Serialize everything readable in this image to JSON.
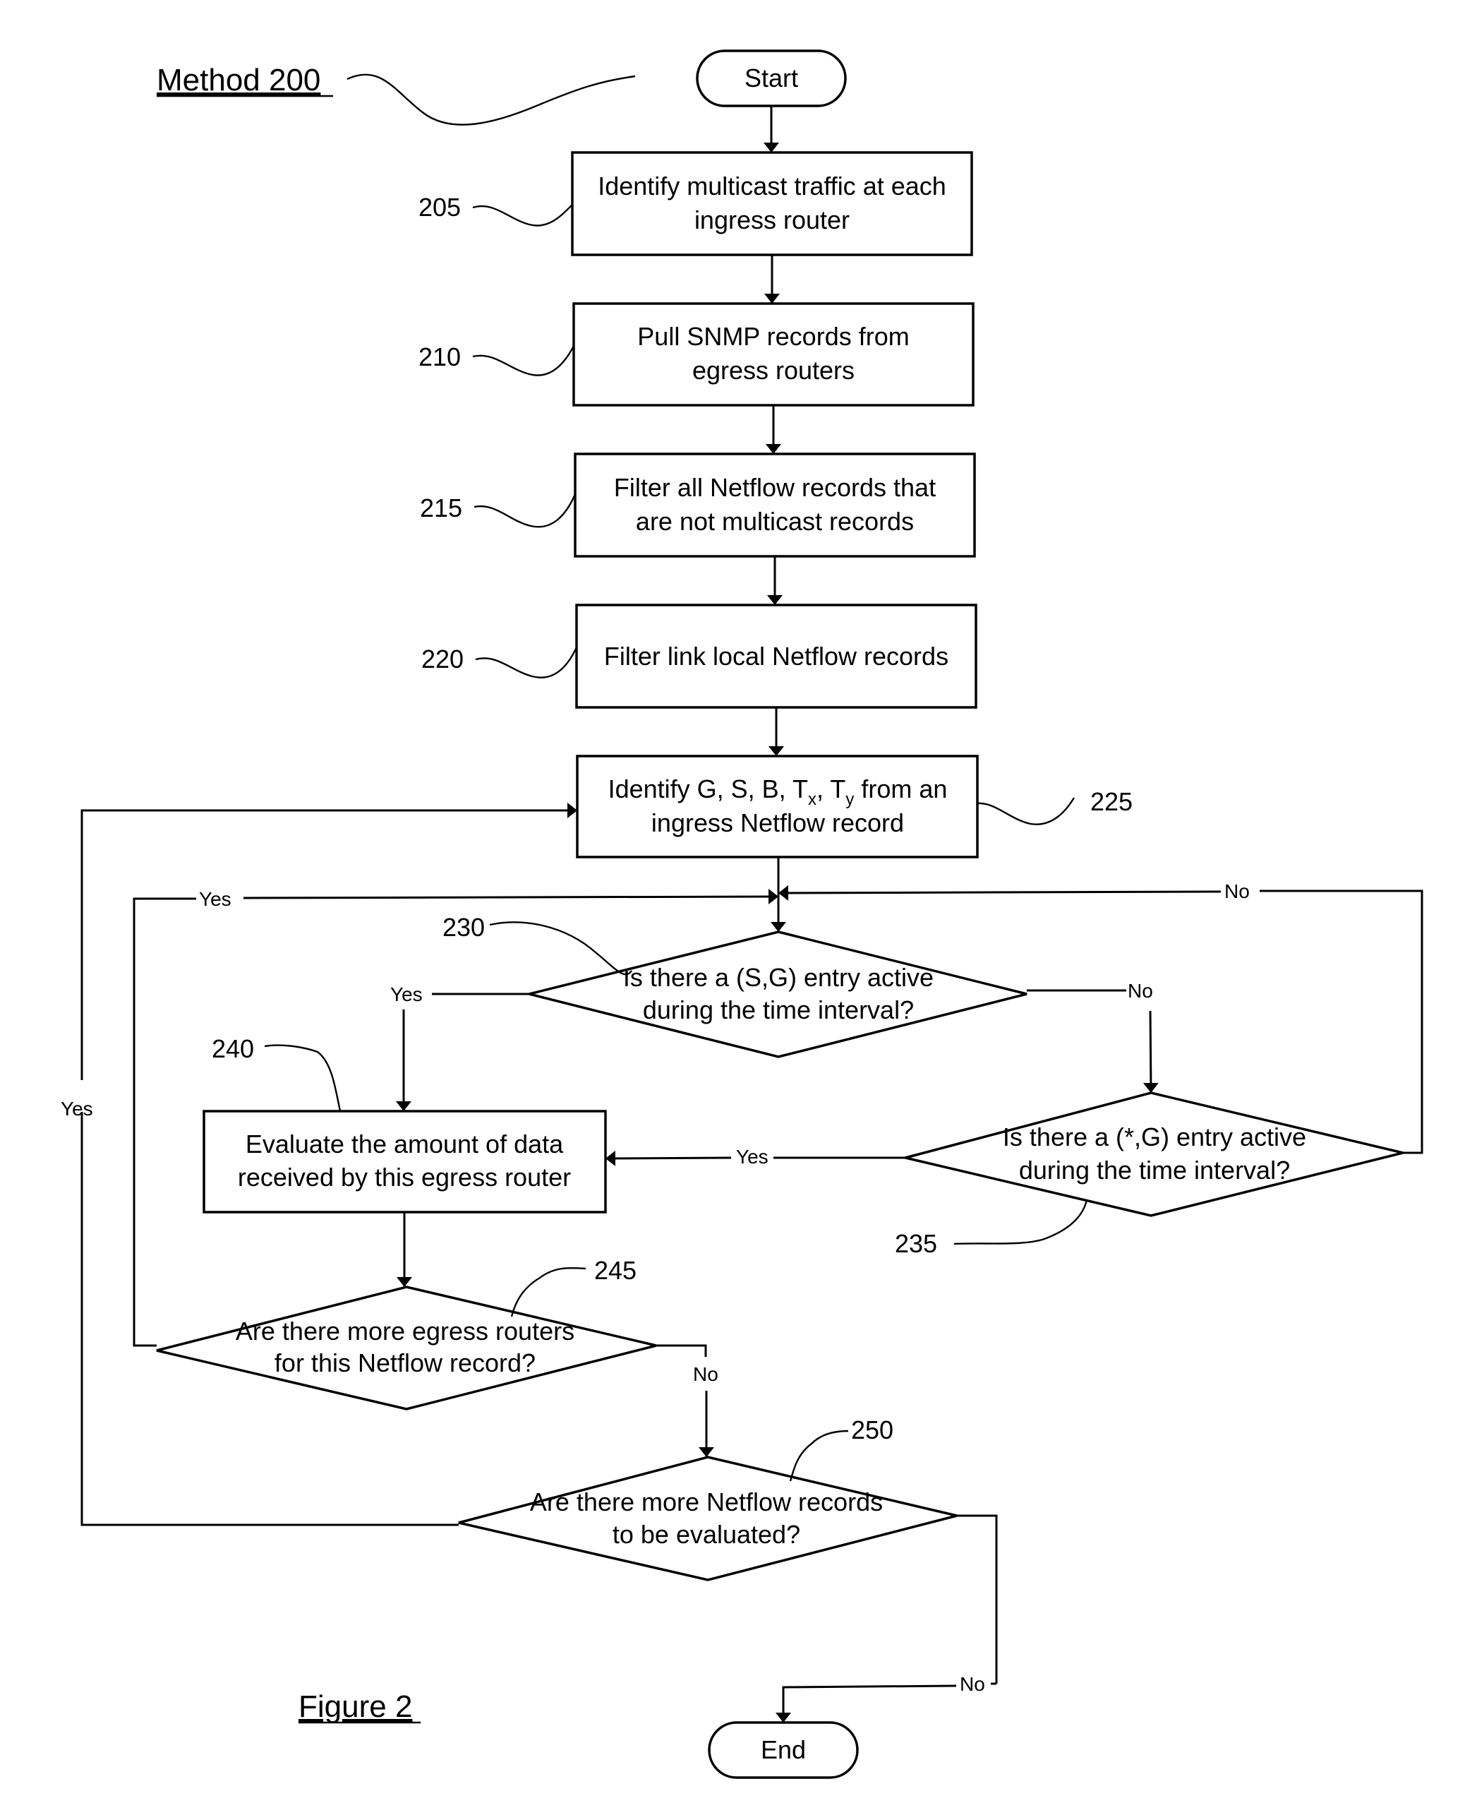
{
  "figure": {
    "method_label": "Method 200",
    "caption": "Figure 2"
  },
  "terminals": {
    "start": "Start",
    "end": "End"
  },
  "steps": [
    {
      "ref": "205",
      "lines": [
        "Identify multicast traffic at each",
        "ingress router"
      ]
    },
    {
      "ref": "210",
      "lines": [
        "Pull SNMP records from",
        "egress routers"
      ]
    },
    {
      "ref": "215",
      "lines": [
        "Filter all Netflow records that",
        "are not multicast records"
      ]
    },
    {
      "ref": "220",
      "lines": [
        "Filter link local Netflow records"
      ]
    },
    {
      "ref": "225",
      "lines_rich": {
        "prefix": "Identify G, S, B, T",
        "sub_x": "x",
        "mid": ", T",
        "sub_y": "y",
        "suffix": " from an",
        "line2": "ingress Netflow record"
      }
    },
    {
      "ref": "240",
      "lines": [
        "Evaluate the amount of data",
        "received by this egress router"
      ]
    }
  ],
  "decisions": [
    {
      "ref": "230",
      "lines": [
        "Is there a (S,G) entry active",
        "during the time interval?"
      ]
    },
    {
      "ref": "235",
      "lines": [
        "Is there a (*,G) entry active",
        "during the time interval?"
      ]
    },
    {
      "ref": "245",
      "lines": [
        "Are there more egress routers",
        "for this Netflow record?"
      ]
    },
    {
      "ref": "250",
      "lines": [
        "Are there more Netflow records",
        "to be evaluated?"
      ]
    }
  ],
  "edge_labels": {
    "yes": "Yes",
    "no": "No"
  }
}
